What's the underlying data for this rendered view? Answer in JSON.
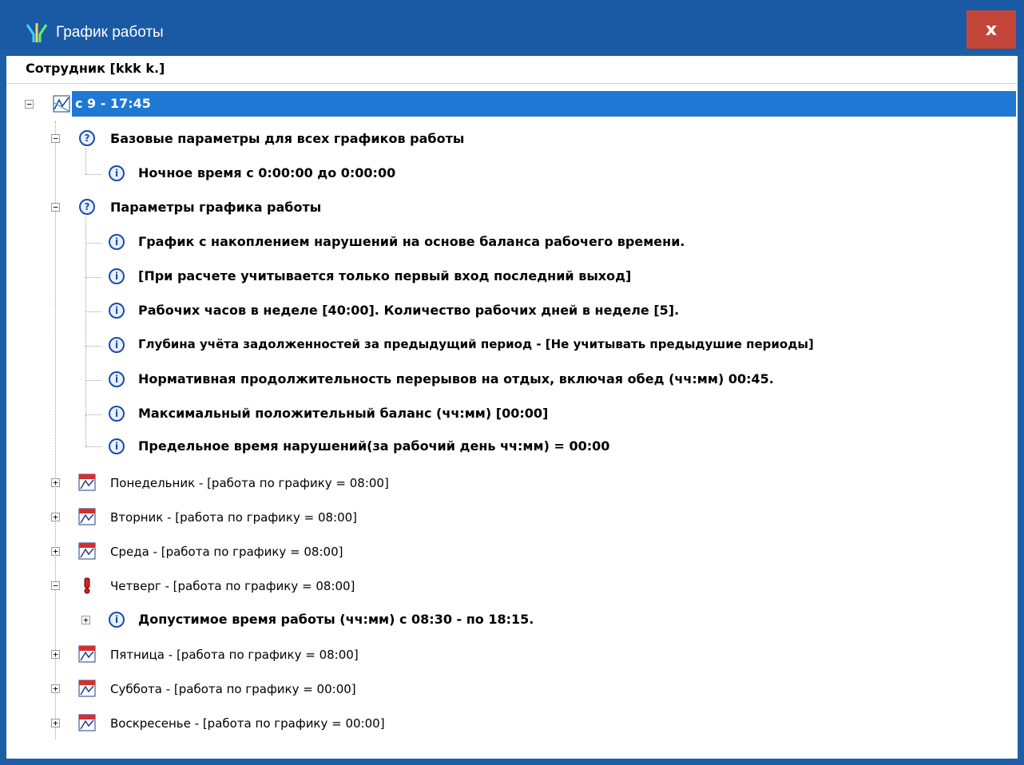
{
  "window": {
    "title": "График работы",
    "close_label": "x"
  },
  "tree_header": "Сотрудник [kkk k.]",
  "root": {
    "label": "с 9 - 17:45",
    "expanded_marker": "−"
  },
  "groups": {
    "base": {
      "label": "Базовые параметры для всех графиков работы",
      "items": [
        "Ночное время с 0:00:00 до 0:00:00"
      ]
    },
    "params": {
      "label": "Параметры графика работы",
      "items": [
        "График с накоплением нарушений на основе баланса рабочего времени.",
        "[При расчете учитывается только первый вход последний выход]",
        "Рабочих часов в неделе [40:00]. Количество рабочих дней в неделе [5].",
        "Глубина учёта задолженностей за предыдущий период  - [Не учитывать предыдушие периоды]",
        "Нормативная продолжительность  перерывов на отдых, включая обед (чч:мм) 00:45.",
        "Максимальный положительный баланс (чч:мм) [00:00]",
        "Предельное время нарушений(за рабочий день чч:мм) = 00:00"
      ]
    }
  },
  "days": [
    "Понедельник - [работа по графику = 08:00]",
    "Вторник - [работа по графику = 08:00]",
    "Среда - [работа по графику = 08:00]",
    "Четверг - [работа по графику = 08:00]",
    "Пятница - [работа по графику = 08:00]",
    "Суббота - [работа по графику = 00:00]",
    "Воскресенье - [работа по графику = 00:00]"
  ],
  "thursday_child": "Допустимое время работы (чч:мм) с 08:30 - по 18:15.",
  "icons": {
    "app": "workflow-icon",
    "root": "schedule-icon",
    "question": "question-icon",
    "info": "info-icon",
    "day": "calendar-icon",
    "warning": "exclamation-icon"
  },
  "colors": {
    "titlebar": "#1a5aa4",
    "close": "#c4463a",
    "selection": "#1e78d4"
  }
}
